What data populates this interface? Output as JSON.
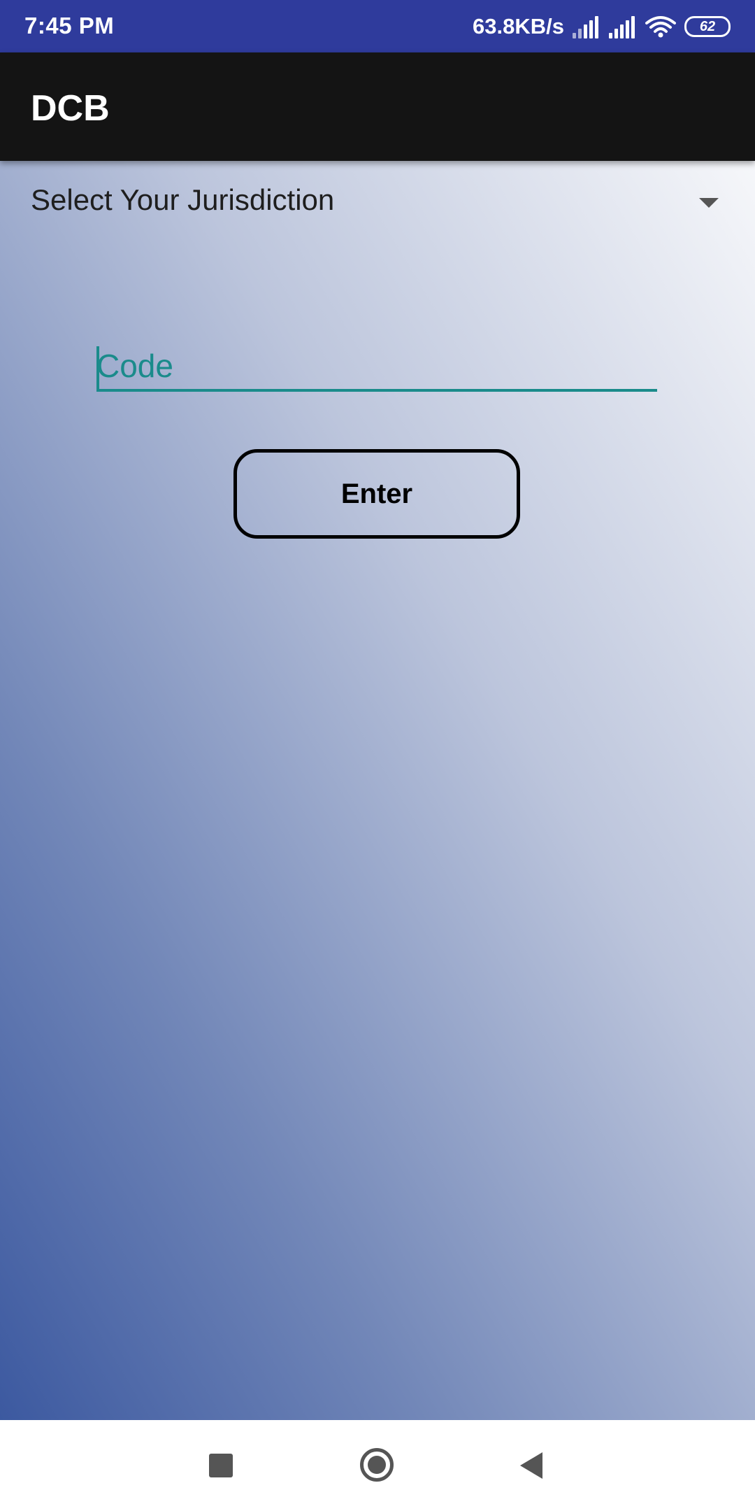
{
  "status_bar": {
    "time": "7:45 PM",
    "net_speed": "63.8KB/s",
    "battery_level": "62",
    "icons": [
      "signal-icon",
      "signal-icon",
      "wifi-icon",
      "battery-icon"
    ]
  },
  "app_bar": {
    "title": "DCB"
  },
  "form": {
    "jurisdiction_label": "Select Your Jurisdiction",
    "code_placeholder": "Code",
    "code_value": "",
    "enter_label": "Enter"
  },
  "nav_bar": {
    "icons": [
      "recents-icon",
      "home-icon",
      "back-icon"
    ]
  },
  "colors": {
    "status_bar": "#2f3b9c",
    "app_bar": "#141414",
    "accent": "#1a8b8b",
    "gradient_dark": "#3c59a0",
    "gradient_light": "#f6f7fa"
  }
}
